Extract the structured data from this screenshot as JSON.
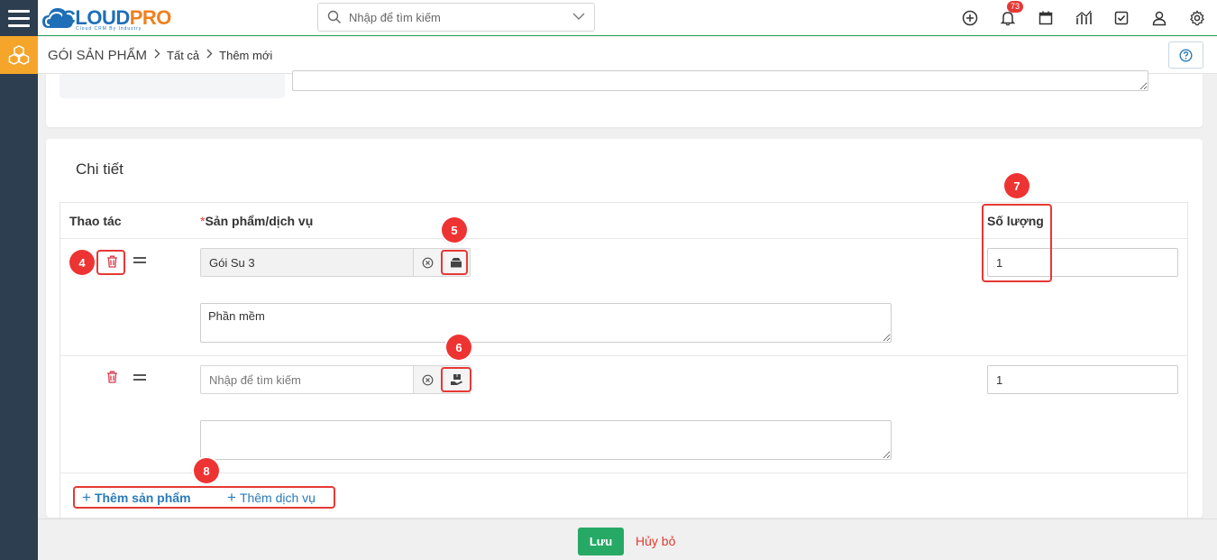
{
  "app": {
    "logo_main_1": "CLOUD",
    "logo_main_2": "PRO",
    "logo_sub": "Cloud CRM By Industry"
  },
  "search": {
    "placeholder": "Nhập để tìm kiếm"
  },
  "header": {
    "notification_count": "73"
  },
  "breadcrumb": {
    "module": "GÓI SẢN PHẨM",
    "items": [
      "Tất cả",
      "Thêm mới"
    ]
  },
  "detail": {
    "title": "Chi tiết",
    "columns": {
      "action": "Thao tác",
      "required_mark": "*",
      "product": "Sản phẩm/dịch vụ",
      "quantity": "Số lượng"
    },
    "rows": [
      {
        "product": "Gói Su 3",
        "product_placeholder": "Nhập để tìm kiếm",
        "description": "Phần mềm",
        "quantity": "1"
      },
      {
        "product": "",
        "product_placeholder": "Nhập để tìm kiếm",
        "description": "",
        "quantity": "1"
      }
    ],
    "add_product": "Thêm sản phẩm",
    "add_service": "Thêm dịch vụ"
  },
  "markers": [
    "4",
    "5",
    "6",
    "7",
    "8"
  ],
  "footer": {
    "save": "Lưu",
    "cancel": "Hủy bỏ"
  },
  "colors": {
    "primary": "#2a7ab8",
    "save": "#27a966",
    "danger": "#e53935",
    "sidebar": "#2c3e50",
    "module": "#f4a52a"
  }
}
